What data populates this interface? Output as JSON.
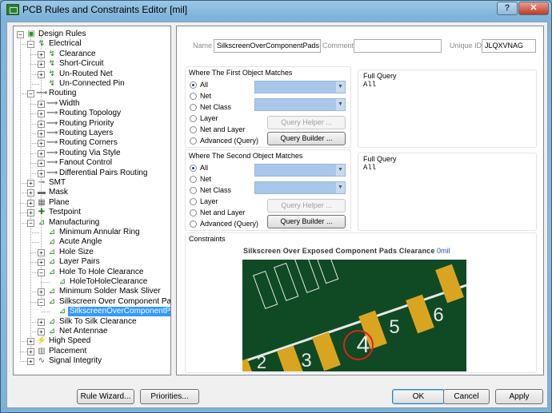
{
  "window": {
    "title": "PCB Rules and Constraints Editor [mil]",
    "help_label": "?",
    "close_label": "✕"
  },
  "tree": [
    {
      "label": "Design Rules",
      "depth": 0,
      "exp": "-",
      "icon": "rules-folder-icon",
      "glyph": "▣",
      "color": "#3a8f2f"
    },
    {
      "label": "Electrical",
      "depth": 1,
      "exp": "-",
      "icon": "electrical-icon",
      "glyph": "↯",
      "color": "#2a7f2a"
    },
    {
      "label": "Clearance",
      "depth": 2,
      "exp": "+",
      "icon": "rule-icon",
      "glyph": "↯",
      "color": "#2a7f2a"
    },
    {
      "label": "Short-Circuit",
      "depth": 2,
      "exp": "+",
      "icon": "rule-icon",
      "glyph": "↯",
      "color": "#2a7f2a"
    },
    {
      "label": "Un-Routed Net",
      "depth": 2,
      "exp": "+",
      "icon": "rule-icon",
      "glyph": "↯",
      "color": "#2a7f2a"
    },
    {
      "label": "Un-Connected Pin",
      "depth": 2,
      "exp": "",
      "icon": "rule-icon",
      "glyph": "↯",
      "color": "#2a7f2a"
    },
    {
      "label": "Routing",
      "depth": 1,
      "exp": "-",
      "icon": "routing-icon",
      "glyph": "⟿",
      "color": "#555"
    },
    {
      "label": "Width",
      "depth": 2,
      "exp": "+",
      "icon": "rule-icon",
      "glyph": "⟿",
      "color": "#555"
    },
    {
      "label": "Routing Topology",
      "depth": 2,
      "exp": "+",
      "icon": "rule-icon",
      "glyph": "⟿",
      "color": "#555"
    },
    {
      "label": "Routing Priority",
      "depth": 2,
      "exp": "+",
      "icon": "rule-icon",
      "glyph": "⟿",
      "color": "#555"
    },
    {
      "label": "Routing Layers",
      "depth": 2,
      "exp": "+",
      "icon": "rule-icon",
      "glyph": "⟿",
      "color": "#555"
    },
    {
      "label": "Routing Corners",
      "depth": 2,
      "exp": "+",
      "icon": "rule-icon",
      "glyph": "⟿",
      "color": "#555"
    },
    {
      "label": "Routing Via Style",
      "depth": 2,
      "exp": "+",
      "icon": "rule-icon",
      "glyph": "⟿",
      "color": "#555"
    },
    {
      "label": "Fanout Control",
      "depth": 2,
      "exp": "+",
      "icon": "rule-icon",
      "glyph": "⟿",
      "color": "#555"
    },
    {
      "label": "Differential Pairs Routing",
      "depth": 2,
      "exp": "+",
      "icon": "rule-icon",
      "glyph": "⟿",
      "color": "#555"
    },
    {
      "label": "SMT",
      "depth": 1,
      "exp": "+",
      "icon": "smt-icon",
      "glyph": "⊸",
      "color": "#555"
    },
    {
      "label": "Mask",
      "depth": 1,
      "exp": "+",
      "icon": "mask-icon",
      "glyph": "▬",
      "color": "#666"
    },
    {
      "label": "Plane",
      "depth": 1,
      "exp": "+",
      "icon": "plane-icon",
      "glyph": "▦",
      "color": "#666"
    },
    {
      "label": "Testpoint",
      "depth": 1,
      "exp": "+",
      "icon": "testpoint-icon",
      "glyph": "✚",
      "color": "#2a7f2a"
    },
    {
      "label": "Manufacturing",
      "depth": 1,
      "exp": "-",
      "icon": "manufacturing-icon",
      "glyph": "⊿",
      "color": "#2a7f2a"
    },
    {
      "label": "Minimum Annular Ring",
      "depth": 2,
      "exp": "",
      "icon": "rule-icon",
      "glyph": "⊿",
      "color": "#2a7f2a"
    },
    {
      "label": "Acute Angle",
      "depth": 2,
      "exp": "",
      "icon": "rule-icon",
      "glyph": "⊿",
      "color": "#2a7f2a"
    },
    {
      "label": "Hole Size",
      "depth": 2,
      "exp": "+",
      "icon": "rule-icon",
      "glyph": "⊿",
      "color": "#2a7f2a"
    },
    {
      "label": "Layer Pairs",
      "depth": 2,
      "exp": "+",
      "icon": "rule-icon",
      "glyph": "⊿",
      "color": "#2a7f2a"
    },
    {
      "label": "Hole To Hole Clearance",
      "depth": 2,
      "exp": "-",
      "icon": "rule-icon",
      "glyph": "⊿",
      "color": "#2a7f2a"
    },
    {
      "label": "HoleToHoleClearance",
      "depth": 3,
      "exp": "",
      "icon": "rule-icon",
      "glyph": "⊿",
      "color": "#2a7f2a"
    },
    {
      "label": "Minimum Solder Mask Sliver",
      "depth": 2,
      "exp": "+",
      "icon": "rule-icon",
      "glyph": "⊿",
      "color": "#2a7f2a"
    },
    {
      "label": "Silkscreen Over Component Pads",
      "depth": 2,
      "exp": "-",
      "icon": "rule-icon",
      "glyph": "⊿",
      "color": "#2a7f2a"
    },
    {
      "label": "SilkscreenOverComponentPads",
      "depth": 3,
      "exp": "",
      "icon": "rule-icon",
      "glyph": "⊿",
      "color": "#2a7f2a",
      "selected": true
    },
    {
      "label": "Silk To Silk Clearance",
      "depth": 2,
      "exp": "+",
      "icon": "rule-icon",
      "glyph": "⊿",
      "color": "#2a7f2a"
    },
    {
      "label": "Net Antennae",
      "depth": 2,
      "exp": "+",
      "icon": "rule-icon",
      "glyph": "⊿",
      "color": "#2a7f2a"
    },
    {
      "label": "High Speed",
      "depth": 1,
      "exp": "+",
      "icon": "high-speed-icon",
      "glyph": "⚡",
      "color": "#c9a100"
    },
    {
      "label": "Placement",
      "depth": 1,
      "exp": "+",
      "icon": "placement-icon",
      "glyph": "▥",
      "color": "#666"
    },
    {
      "label": "Signal Integrity",
      "depth": 1,
      "exp": "+",
      "icon": "signal-integrity-icon",
      "glyph": "∿",
      "color": "#555"
    }
  ],
  "rule": {
    "name_label": "Name",
    "name_value": "SilkscreenOverComponentPads",
    "comment_label": "Comment",
    "comment_value": "",
    "uid_label": "Unique ID",
    "uid_value": "JLQXVNAG"
  },
  "first": {
    "title": "Where The First Object Matches",
    "options": [
      "All",
      "Net",
      "Net Class",
      "Layer",
      "Net and Layer",
      "Advanced (Query)"
    ],
    "selected": 0,
    "query_helper": "Query Helper ...",
    "query_builder": "Query Builder ...",
    "full_query_title": "Full Query",
    "full_query": "All"
  },
  "second": {
    "title": "Where The Second Object Matches",
    "options": [
      "All",
      "Net",
      "Net Class",
      "Layer",
      "Net and Layer",
      "Advanced (Query)"
    ],
    "selected": 0,
    "query_helper": "Query Helper ...",
    "query_builder": "Query Builder ...",
    "full_query_title": "Full Query",
    "full_query": "All"
  },
  "constraints": {
    "title": "Constraints",
    "caption": "Silkscreen Over Exposed Component Pads Clearance",
    "value": "0mil",
    "pad_numbers": [
      "2",
      "3",
      "4",
      "5",
      "6"
    ],
    "colors": {
      "board": "#0f4a24",
      "pad": "#d9a520",
      "silk": "#e8e8e8",
      "marker": "#e02020"
    }
  },
  "buttons": {
    "rule_wizard": "Rule Wizard...",
    "priorities": "Priorities...",
    "ok": "OK",
    "cancel": "Cancel",
    "apply": "Apply"
  }
}
